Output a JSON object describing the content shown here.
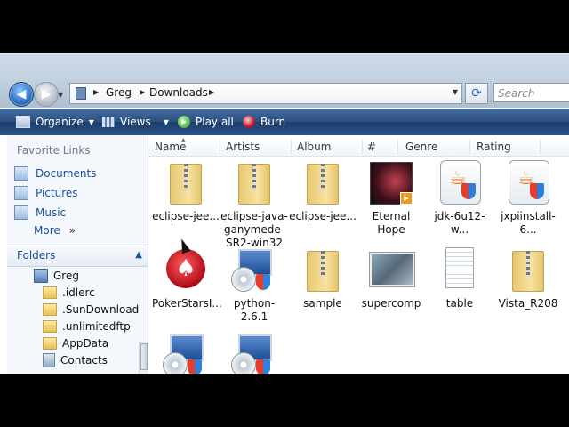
{
  "address": {
    "crumbs": [
      "Greg",
      "Downloads"
    ],
    "search_placeholder": "Search"
  },
  "toolbar": {
    "organize": "Organize",
    "views": "Views",
    "play_all": "Play all",
    "burn": "Burn"
  },
  "nav": {
    "favorite_links_title": "Favorite Links",
    "favorites": [
      "Documents",
      "Pictures",
      "Music"
    ],
    "more": "More",
    "more_glyph": "»",
    "folders_title": "Folders",
    "tree": [
      "Greg",
      ".idlerc",
      ".SunDownload",
      ".unlimitedftp",
      "AppData",
      "Contacts"
    ]
  },
  "columns": [
    "Name",
    "Artists",
    "Album",
    "#",
    "Genre",
    "Rating"
  ],
  "files": [
    {
      "label": "eclipse-jee...",
      "icon": "zip-folder-icon"
    },
    {
      "label": "eclipse-java-ganymede-SR2-win32",
      "icon": "zip-folder-icon"
    },
    {
      "label": "eclipse-jee...",
      "icon": "zip-folder-icon"
    },
    {
      "label": "Eternal Hope",
      "icon": "media-file-icon"
    },
    {
      "label": "jdk-6u12-w...",
      "icon": "java-installer-icon"
    },
    {
      "label": "jxpiinstall-6...",
      "icon": "java-installer-icon"
    },
    {
      "label": "PokerStarsI...",
      "icon": "pokerstars-icon"
    },
    {
      "label": "python-2.6.1",
      "icon": "installer-icon"
    },
    {
      "label": "sample",
      "icon": "zip-folder-icon"
    },
    {
      "label": "supercomp",
      "icon": "photo-icon"
    },
    {
      "label": "table",
      "icon": "text-document-icon"
    },
    {
      "label": "Vista_R208",
      "icon": "zip-folder-icon"
    },
    {
      "label": "",
      "icon": "installer-icon"
    },
    {
      "label": "",
      "icon": "installer-icon"
    }
  ]
}
